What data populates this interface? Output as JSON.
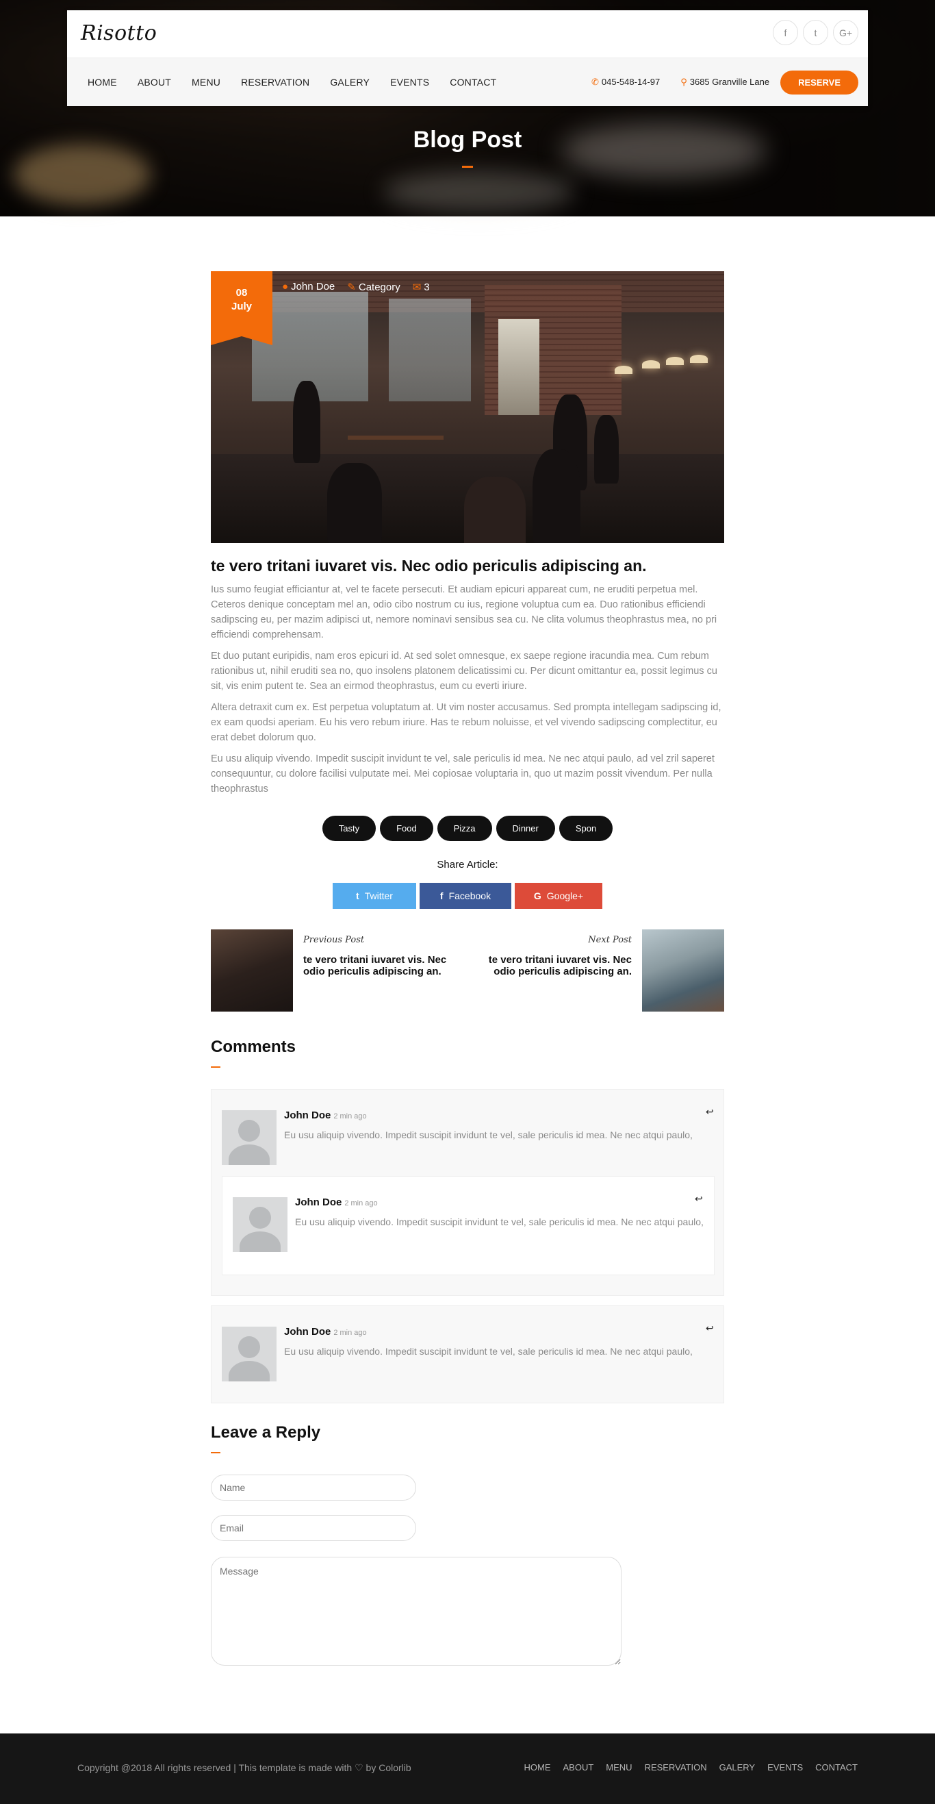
{
  "brand": {
    "logo": "Risotto"
  },
  "nav": {
    "items": [
      {
        "label": "HOME"
      },
      {
        "label": "ABOUT"
      },
      {
        "label": "MENU"
      },
      {
        "label": "RESERVATION"
      },
      {
        "label": "GALERY"
      },
      {
        "label": "EVENTS"
      },
      {
        "label": "CONTACT"
      }
    ],
    "phone": "045-548-14-97",
    "address": "3685 Granville Lane",
    "reserve_label": "RESERVE"
  },
  "socials": [
    {
      "icon": "facebook-icon",
      "glyph": "f"
    },
    {
      "icon": "twitter-icon",
      "glyph": "t"
    },
    {
      "icon": "google-plus-icon",
      "glyph": "G+"
    }
  ],
  "hero": {
    "title": "Blog Post"
  },
  "post": {
    "date_day": "08",
    "date_month": "July",
    "author": "John Doe",
    "category": "Category",
    "comments_count": "3",
    "title": "te vero tritani iuvaret vis. Nec odio periculis adipiscing an.",
    "paragraphs": [
      "Ius sumo feugiat efficiantur at, vel te facete persecuti. Et audiam epicuri appareat cum, ne eruditi perpetua mel. Ceteros denique conceptam mel an, odio cibo nostrum cu ius, regione voluptua cum ea. Duo rationibus efficiendi sadipscing eu, per mazim adipisci ut, nemore nominavi sensibus sea cu. Ne clita volumus theophrastus mea, no pri efficiendi comprehensam.",
      "Et duo putant euripidis, nam eros epicuri id. At sed solet omnesque, ex saepe regione iracundia mea. Cum rebum rationibus ut, nihil eruditi sea no, quo insolens platonem delicatissimi cu. Per dicunt omittantur ea, possit legimus cu sit, vis enim putent te. Sea an eirmod theophrastus, eum cu everti iriure.",
      "Altera detraxit cum ex. Est perpetua voluptatum at. Ut vim noster accusamus. Sed prompta intellegam sadipscing id, ex eam quodsi aperiam. Eu his vero rebum iriure. Has te rebum noluisse, et vel vivendo sadipscing complectitur, eu erat debet dolorum quo.",
      "Eu usu aliquip vivendo. Impedit suscipit invidunt te vel, sale periculis id mea. Ne nec atqui paulo, ad vel zril saperet consequuntur, cu dolore facilisi vulputate mei. Mei copiosae voluptaria in, quo ut mazim possit vivendum. Per nulla theophrastus"
    ],
    "tags": [
      "Tasty",
      "Food",
      "Pizza",
      "Dinner",
      "Spon"
    ],
    "share_title": "Share Article:",
    "share": [
      {
        "label": "Twitter",
        "color": "#55acee"
      },
      {
        "label": "Facebook",
        "color": "#3b5998"
      },
      {
        "label": "Google+",
        "color": "#dd4b39"
      }
    ],
    "prev": {
      "label": "Previous Post",
      "title": "te vero tritani iuvaret vis. Nec odio periculis adipiscing an."
    },
    "next": {
      "label": "Next Post",
      "title": "te vero tritani iuvaret vis. Nec odio periculis adipiscing an."
    }
  },
  "comments": {
    "title": "Comments",
    "items": [
      {
        "name": "John Doe",
        "time": "2 min ago",
        "text": "Eu usu aliquip vivendo. Impedit suscipit invidunt te vel, sale periculis id mea. Ne nec atqui paulo,"
      },
      {
        "name": "John Doe",
        "time": "2 min ago",
        "text": "Eu usu aliquip vivendo. Impedit suscipit invidunt te vel, sale periculis id mea. Ne nec atqui paulo,"
      },
      {
        "name": "John Doe",
        "time": "2 min ago",
        "text": "Eu usu aliquip vivendo. Impedit suscipit invidunt te vel, sale periculis id mea. Ne nec atqui paulo,"
      }
    ]
  },
  "reply_form": {
    "title": "Leave a Reply",
    "name_placeholder": "Name",
    "email_placeholder": "Email",
    "message_placeholder": "Message"
  },
  "footer": {
    "copyright": "Copyright @2018 All rights reserved | This template is made with ♡ by Colorlib",
    "items": [
      {
        "label": "HOME"
      },
      {
        "label": "ABOUT"
      },
      {
        "label": "MENU"
      },
      {
        "label": "RESERVATION"
      },
      {
        "label": "GALERY"
      },
      {
        "label": "EVENTS"
      },
      {
        "label": "CONTACT"
      }
    ]
  },
  "colors": {
    "accent": "#f36b0a",
    "footer_bg": "#161616"
  }
}
